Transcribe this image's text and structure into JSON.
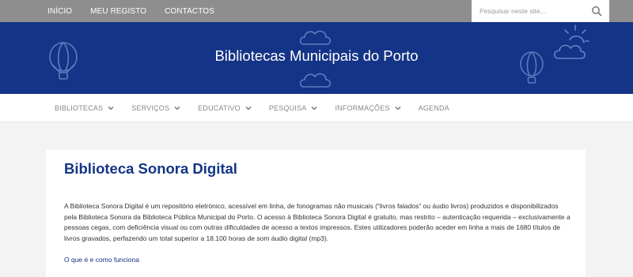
{
  "top_nav": {
    "items": [
      "INÍCIO",
      "MEU REGISTO",
      "CONTACTOS"
    ]
  },
  "search": {
    "placeholder": "Pesquisar neste site...",
    "icon": "search-icon"
  },
  "banner": {
    "title": "Bibliotecas Municipais do Porto",
    "icons": [
      "balloon-icon",
      "cloud-icon",
      "sun-cloud-icon"
    ]
  },
  "main_nav": {
    "items": [
      {
        "label": "BIBLIOTECAS",
        "dropdown": true
      },
      {
        "label": "SERVIÇOS",
        "dropdown": true
      },
      {
        "label": "EDUCATIVO",
        "dropdown": true
      },
      {
        "label": "PESQUISA",
        "dropdown": true
      },
      {
        "label": "INFORMAÇÕES",
        "dropdown": true
      },
      {
        "label": "AGENDA",
        "dropdown": false
      }
    ]
  },
  "content": {
    "title": "Biblioteca Sonora Digital",
    "intro": "A Biblioteca Sonora Digital é um repositório eletrónico, acessível em linha, de fonogramas não musicais (“livros falados” ou áudio livros) produzidos e disponibilizados pela Biblioteca Sonora da Biblioteca Pública Municipal do Porto. O acesso à Biblioteca Sonora Digital é gratuito, mas restrito – autenticação requerida – exclusivamente a pessoas cegas, com deficiência visual ou com outras dificuldades de acesso a textos impressos. Estes utilizadores poderão aceder em linha a mais de 1680 títulos de livros gravados, perfazendo um total superior a 18.100 horas de som áudio digital (mp3).",
    "link": "O que é e como funciona"
  },
  "colors": {
    "topbar": "#8e8e8e",
    "banner": "#143487",
    "accent": "#143487",
    "background": "#f3f3f3"
  }
}
